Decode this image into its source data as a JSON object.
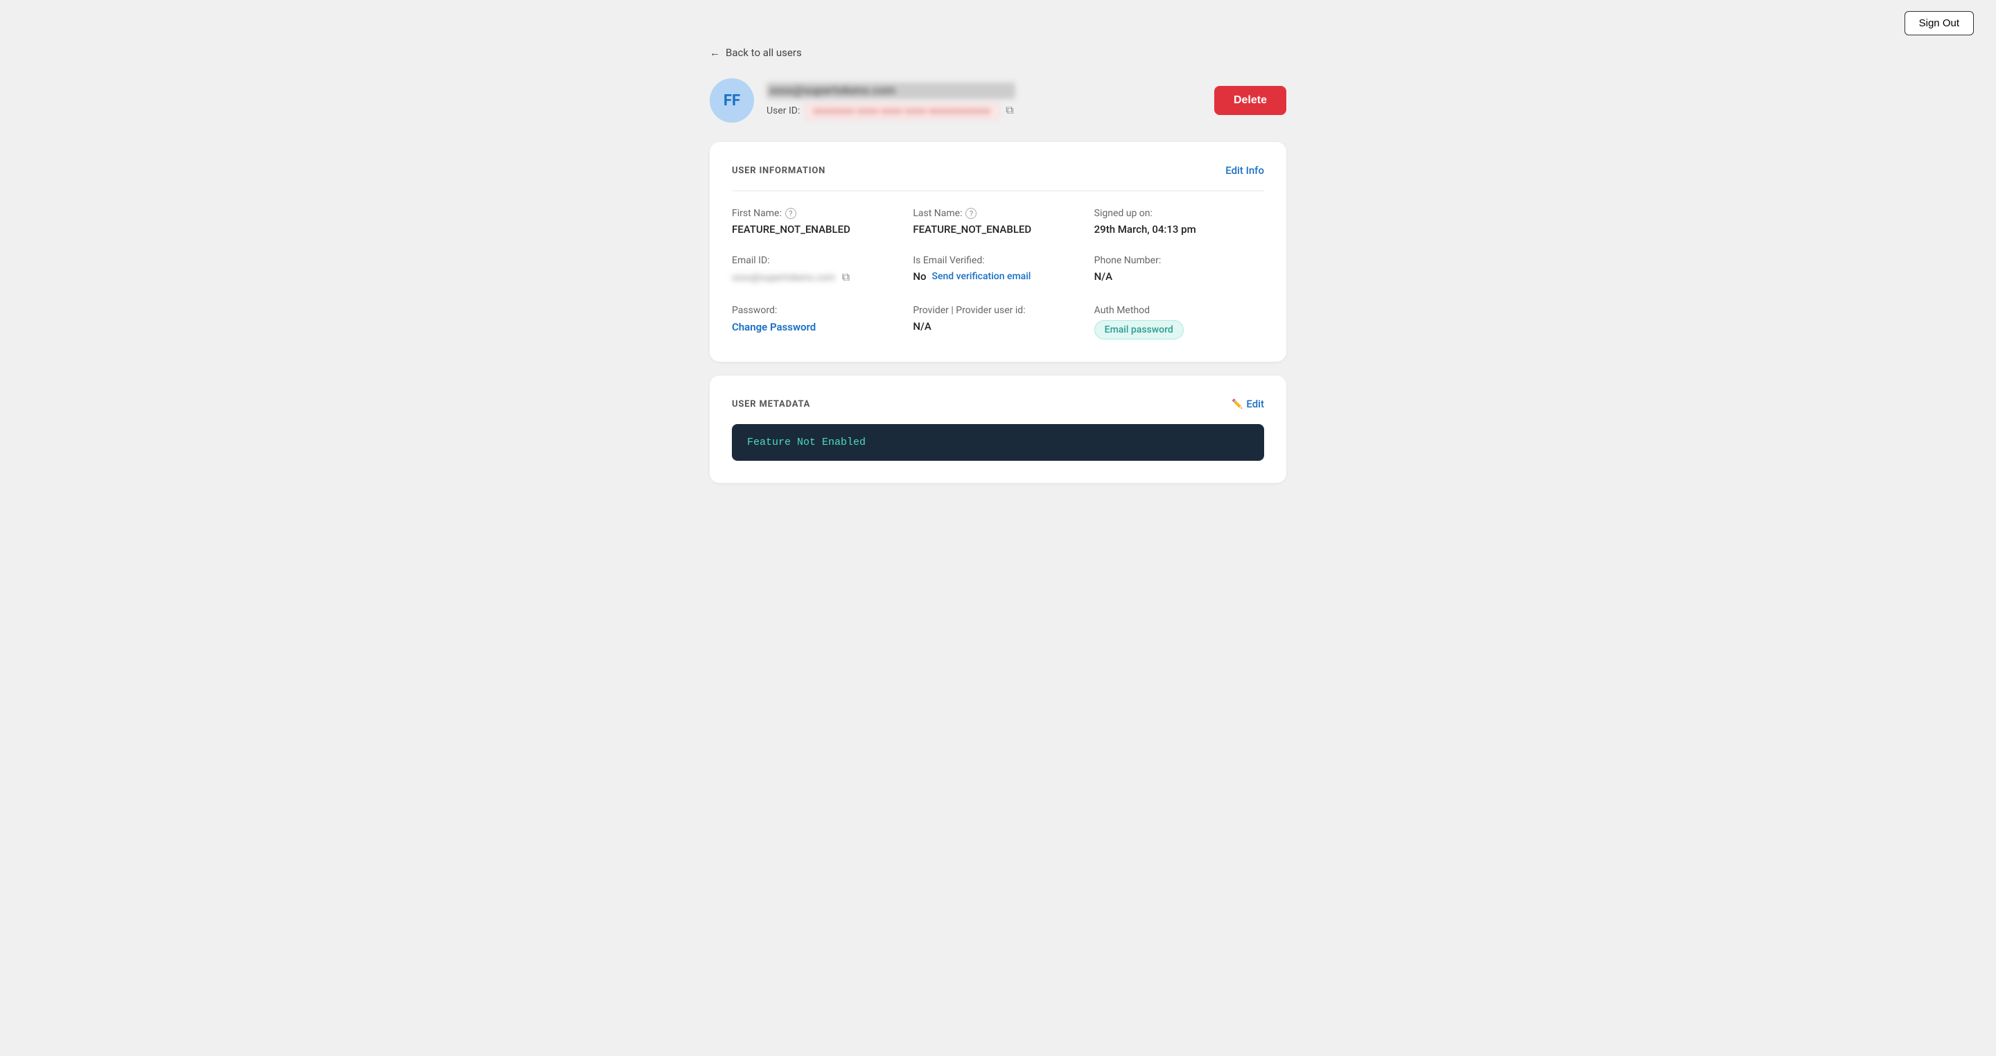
{
  "topbar": {
    "sign_out_label": "Sign Out"
  },
  "back": {
    "label": "Back to all users"
  },
  "user": {
    "avatar_initials": "FF",
    "email": "xxxx@supertokens.com",
    "user_id_label": "User ID:",
    "user_id_value": "xxxxxxxx-xxxx-xxxx-xxxx-xxxxxxxxxxxx"
  },
  "delete_button": {
    "label": "Delete"
  },
  "user_information": {
    "section_title": "USER INFORMATION",
    "edit_info_label": "Edit Info",
    "first_name": {
      "label": "First Name:",
      "value": "FEATURE_NOT_ENABLED"
    },
    "last_name": {
      "label": "Last Name:",
      "value": "FEATURE_NOT_ENABLED"
    },
    "signed_up": {
      "label": "Signed up on:",
      "value": "29th March, 04:13 pm"
    },
    "email_id": {
      "label": "Email ID:",
      "value": "xxxx@supertokens.com"
    },
    "is_email_verified": {
      "label": "Is Email Verified:",
      "value": "No",
      "send_verification_label": "Send verification email"
    },
    "phone_number": {
      "label": "Phone Number:",
      "value": "N/A"
    },
    "password": {
      "label": "Password:",
      "change_label": "Change Password"
    },
    "provider": {
      "label": "Provider | Provider user id:",
      "value": "N/A"
    },
    "auth_method": {
      "label": "Auth Method",
      "badge": "Email password"
    }
  },
  "user_metadata": {
    "section_title": "USER METADATA",
    "edit_label": "Edit",
    "code_content": "Feature Not Enabled"
  }
}
